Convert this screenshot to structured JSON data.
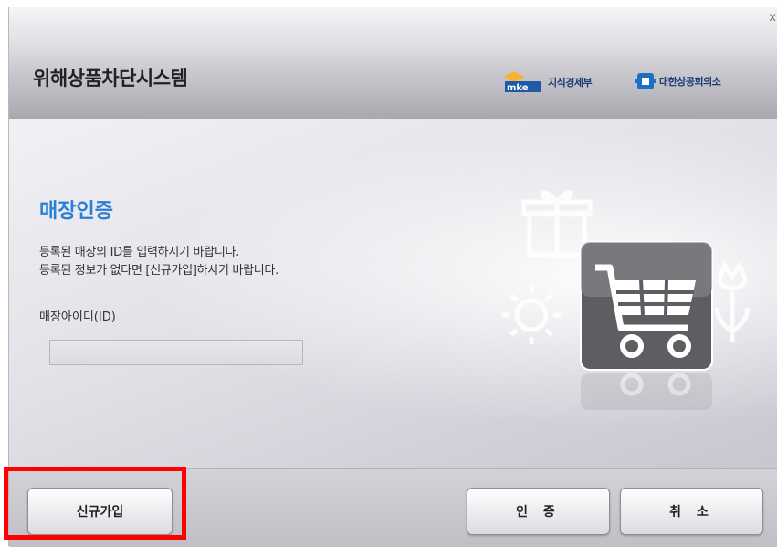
{
  "window": {
    "close_glyph": "x",
    "title": "위해상품차단시스템",
    "logos": {
      "mke_text": "지식경제부",
      "kcci_text": "대한상공회의소"
    }
  },
  "auth": {
    "title": "매장인증",
    "desc_line1": "등록된 매장의 ID를 입력하시기 바랍니다.",
    "desc_line2": "등록된 정보가 없다면 [신규가입]하시기 바랍니다.",
    "id_label": "매장아이디(ID)",
    "id_value": ""
  },
  "buttons": {
    "signup": "신규가입",
    "authenticate": "인 증",
    "cancel": "취 소"
  },
  "colors": {
    "accent_title": "#2a7fd6",
    "highlight_box": "#ff0000"
  },
  "icons": [
    "close-icon",
    "mke-logo-icon",
    "kcci-logo-icon",
    "gift-icon",
    "shopping-cart-icon",
    "sun-icon",
    "tulip-icon"
  ]
}
